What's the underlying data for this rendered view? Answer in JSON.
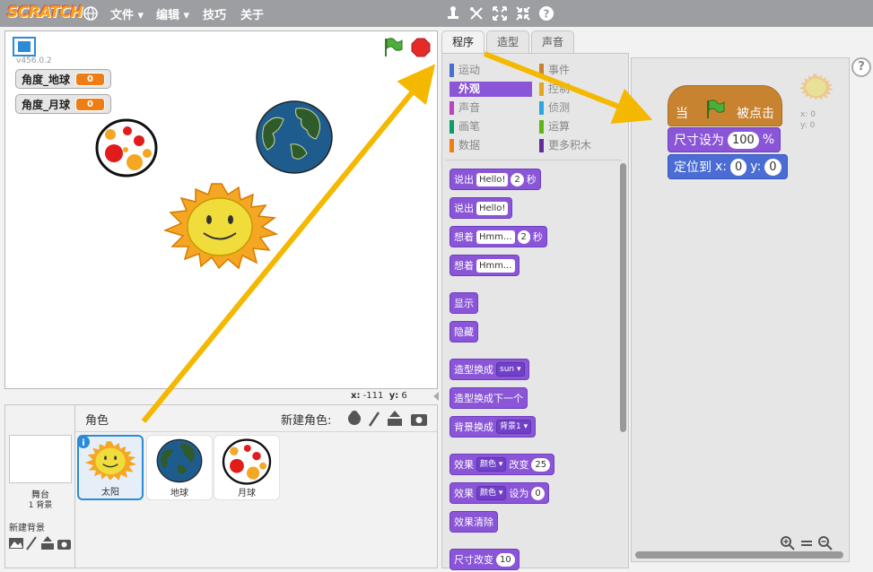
{
  "app": {
    "logo": "SCRATCH"
  },
  "menu": {
    "file": "文件 ▾",
    "edit": "编辑 ▾",
    "tips": "技巧",
    "about": "关于"
  },
  "stage": {
    "version": "v456.0.2",
    "vars": [
      {
        "name": "角度_地球",
        "value": "0"
      },
      {
        "name": "角度_月球",
        "value": "0"
      }
    ],
    "coords": {
      "x_label": "x:",
      "x": "-111",
      "y_label": "y:",
      "y": "6"
    }
  },
  "sprites": {
    "header": "角色",
    "new_sprite": "新建角色:",
    "stage_label": "舞台",
    "stage_bg_count": "1 背景",
    "new_backdrop": "新建背景",
    "items": [
      {
        "name": "太阳",
        "selected": true
      },
      {
        "name": "地球",
        "selected": false
      },
      {
        "name": "月球",
        "selected": false
      }
    ]
  },
  "tabs": [
    "程序",
    "造型",
    "声音"
  ],
  "categories": [
    {
      "label": "运动",
      "color": "#4a6cd4"
    },
    {
      "label": "事件",
      "color": "#c88330"
    },
    {
      "label": "外观",
      "color": "#8a55d7",
      "selected": true
    },
    {
      "label": "控制",
      "color": "#e1a91a"
    },
    {
      "label": "声音",
      "color": "#bb42c3"
    },
    {
      "label": "侦测",
      "color": "#2ca5e2"
    },
    {
      "label": "画笔",
      "color": "#0e9a6c"
    },
    {
      "label": "运算",
      "color": "#5cb712"
    },
    {
      "label": "数据",
      "color": "#ee7d16"
    },
    {
      "label": "更多积木",
      "color": "#632d99"
    }
  ],
  "palette": {
    "say_secs": {
      "label": "说出",
      "text": "Hello!",
      "secs": "2",
      "unit": "秒"
    },
    "say": {
      "label": "说出",
      "text": "Hello!"
    },
    "think_secs": {
      "label": "想着",
      "text": "Hmm...",
      "secs": "2",
      "unit": "秒"
    },
    "think": {
      "label": "想着",
      "text": "Hmm..."
    },
    "show": "显示",
    "hide": "隐藏",
    "switch_costume": {
      "label": "造型换成",
      "value": "sun"
    },
    "next_costume": "造型换成下一个",
    "switch_backdrop": {
      "label": "背景换成",
      "value": "背景1"
    },
    "change_effect": {
      "label": "效果",
      "effect": "颜色",
      "verb": "改变",
      "value": "25"
    },
    "set_effect": {
      "label": "效果",
      "effect": "颜色",
      "verb": "设为",
      "value": "0"
    },
    "clear_effects": "效果清除",
    "change_size": {
      "label": "尺寸改变",
      "value": "10"
    }
  },
  "script": {
    "hat_when": "当",
    "hat_clicked": "被点击",
    "set_size": {
      "label": "尺寸设为",
      "value": "100",
      "unit": "%"
    },
    "goto": {
      "label": "定位到",
      "x_label": "x:",
      "x": "0",
      "y_label": "y:",
      "y": "0"
    },
    "sprite_x": "x: 0",
    "sprite_y": "y: 0"
  },
  "help": "?",
  "colors": {
    "accent_arrow": "#f5b800",
    "looks": "#8a55d7",
    "events": "#c88330",
    "motion": "#4a6cd4"
  }
}
